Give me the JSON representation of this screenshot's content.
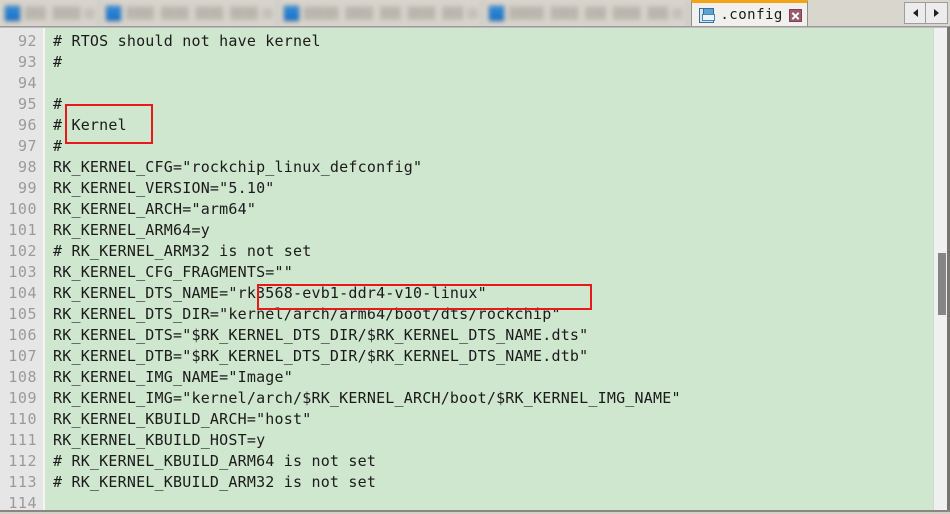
{
  "window": {
    "title": ".config"
  },
  "tabbar": {
    "obscured_tabs": [
      {
        "label": "███ ████",
        "icon": "file-icon"
      },
      {
        "label": "████ ████ ████ ████",
        "icon": "file-icon"
      },
      {
        "label": "█████ ████ ███ ████ ███",
        "icon": "file-icon"
      },
      {
        "label": "█████ ████ ███ ████ ███",
        "icon": "file-icon"
      }
    ],
    "active_tab": {
      "label": ".config",
      "icon": "floppy-save-icon",
      "close_icon": "close-x-icon",
      "accent_color": "#f2a416"
    },
    "nav": {
      "prev_icon": "triangle-left-icon",
      "next_icon": "triangle-right-icon"
    }
  },
  "editor": {
    "background_color": "#cfe6cf",
    "gutter_color": "#e6e6e6",
    "line_number_color": "#9a9a9a",
    "first_line_number": 92,
    "lines": [
      {
        "n": "92",
        "text": "# RTOS should not have kernel"
      },
      {
        "n": "93",
        "text": "#"
      },
      {
        "n": "94",
        "text": ""
      },
      {
        "n": "95",
        "text": "#"
      },
      {
        "n": "96",
        "text": "# Kernel"
      },
      {
        "n": "97",
        "text": "#"
      },
      {
        "n": "98",
        "text": "RK_KERNEL_CFG=\"rockchip_linux_defconfig\""
      },
      {
        "n": "99",
        "text": "RK_KERNEL_VERSION=\"5.10\""
      },
      {
        "n": "100",
        "text": "RK_KERNEL_ARCH=\"arm64\""
      },
      {
        "n": "101",
        "text": "RK_KERNEL_ARM64=y"
      },
      {
        "n": "102",
        "text": "# RK_KERNEL_ARM32 is not set"
      },
      {
        "n": "103",
        "text": "RK_KERNEL_CFG_FRAGMENTS=\"\""
      },
      {
        "n": "104",
        "text": "RK_KERNEL_DTS_NAME=\"rk3568-evb1-ddr4-v10-linux\""
      },
      {
        "n": "105",
        "text": "RK_KERNEL_DTS_DIR=\"kernel/arch/arm64/boot/dts/rockchip\""
      },
      {
        "n": "106",
        "text": "RK_KERNEL_DTS=\"$RK_KERNEL_DTS_DIR/$RK_KERNEL_DTS_NAME.dts\""
      },
      {
        "n": "107",
        "text": "RK_KERNEL_DTB=\"$RK_KERNEL_DTS_DIR/$RK_KERNEL_DTS_NAME.dtb\""
      },
      {
        "n": "108",
        "text": "RK_KERNEL_IMG_NAME=\"Image\""
      },
      {
        "n": "109",
        "text": "RK_KERNEL_IMG=\"kernel/arch/$RK_KERNEL_ARCH/boot/$RK_KERNEL_IMG_NAME\""
      },
      {
        "n": "110",
        "text": "RK_KERNEL_KBUILD_ARCH=\"host\""
      },
      {
        "n": "111",
        "text": "RK_KERNEL_KBUILD_HOST=y"
      },
      {
        "n": "112",
        "text": "# RK_KERNEL_KBUILD_ARM64 is not set"
      },
      {
        "n": "113",
        "text": "# RK_KERNEL_KBUILD_ARM32 is not set"
      },
      {
        "n": "114",
        "text": ""
      }
    ]
  },
  "annotations": {
    "color": "#e8191b",
    "boxes": [
      {
        "id": "kernel",
        "target_text": "Kernel",
        "line": "96"
      },
      {
        "id": "dts-name",
        "target_text": "\"rk3568-evb1-ddr4-v10-linux\"",
        "line": "104"
      }
    ]
  },
  "scrollbar": {
    "orientation": "vertical",
    "thumb_color": "#858585",
    "track_color": "#f0f0f0"
  }
}
